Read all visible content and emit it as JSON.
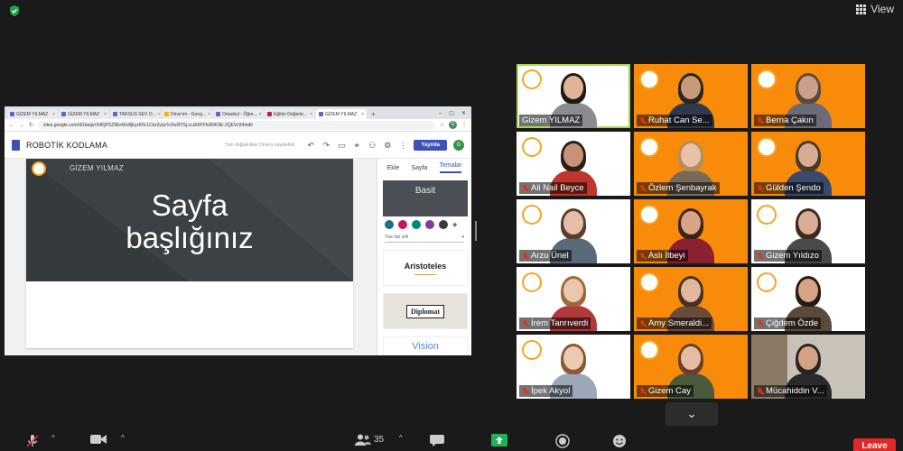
{
  "top": {
    "view_label": "View"
  },
  "browser": {
    "tabs": [
      {
        "label": "GİZEM YILMAZ"
      },
      {
        "label": "GİZEM YILMAZ"
      },
      {
        "label": "TARSUS SEV O..."
      },
      {
        "label": "Drive'ım - Goog..."
      },
      {
        "label": "Ortaokul - Öğre..."
      },
      {
        "label": "Eğitim Değerle..."
      },
      {
        "label": "GİZEM YILMAZ"
      }
    ],
    "url": "sites.google.com/d/1baijuVh8QF5Z9EeWc8jkyzKfIc1Ckz2y/p/1c5u6lYSj-cczk6FFfxR9K3E-2QEVc94/edit",
    "site_title": "ROBOTİK KODLAMA",
    "draft_note": "Tüm değişiklikler Drive'a kaydedildi",
    "publish_label": "Yayınla",
    "avatar_letter": "G",
    "hero_name": "GİZEM YILMAZ",
    "hero_title_line1": "Sayfa",
    "hero_title_line2": "başlığınız",
    "panel_tabs": [
      "Ekle",
      "Sayfa",
      "Temalar"
    ],
    "theme_selected": "Basit",
    "font_style": "Yazı tipi stili",
    "themes": [
      "Aristoteles",
      "Diplomat",
      "Vision"
    ],
    "swatch_colors": [
      "#1f6f8b",
      "#c2185b",
      "#00897b",
      "#7b3fa0",
      "#3b3b3b"
    ]
  },
  "participants": [
    {
      "name": "Gizem YILMAZ",
      "bg": "white",
      "muted": false,
      "active": true,
      "hair": "#1e1a18",
      "skin": "#e2b497",
      "shirt": "#8a8d90"
    },
    {
      "name": "Ruhat Can Se...",
      "bg": "orange",
      "muted": true,
      "active": false,
      "hair": "#2a2522",
      "skin": "#c7987a",
      "shirt": "#2f3b4a"
    },
    {
      "name": "Berna Çakın",
      "bg": "orange",
      "muted": true,
      "active": false,
      "hair": "#5a4a3a",
      "skin": "#caa08a",
      "shirt": "#6b6b7a"
    },
    {
      "name": "Ali Nail Beyce",
      "bg": "white",
      "muted": true,
      "active": false,
      "hair": "#2a2018",
      "skin": "#c89276",
      "shirt": "#c0362c"
    },
    {
      "name": "Özlem Şenbayrak",
      "bg": "orange",
      "muted": true,
      "active": false,
      "hair": "#b58c5a",
      "skin": "#e8c2a8",
      "shirt": "#7a6a5a"
    },
    {
      "name": "Gülden Şendo",
      "bg": "orange",
      "muted": true,
      "active": false,
      "hair": "#4a3a2a",
      "skin": "#d9ab92",
      "shirt": "#3a4a6a"
    },
    {
      "name": "Arzu Ünel",
      "bg": "white",
      "muted": true,
      "active": false,
      "hair": "#5a3d2a",
      "skin": "#e4bea6",
      "shirt": "#5a6a7a"
    },
    {
      "name": "Aslı İlbeyi",
      "bg": "orange",
      "muted": true,
      "active": false,
      "hair": "#3a2418",
      "skin": "#d8a488",
      "shirt": "#8a2030"
    },
    {
      "name": "Gizem Yıldızo",
      "bg": "white",
      "muted": true,
      "active": false,
      "hair": "#3a2a20",
      "skin": "#d9ad95",
      "shirt": "#4a4a4a"
    },
    {
      "name": "İrem Tanrıverdi",
      "bg": "white",
      "muted": true,
      "active": false,
      "hair": "#9a6a3a",
      "skin": "#ecc6ad",
      "shirt": "#b03a3a"
    },
    {
      "name": "Amy Smeraldi...",
      "bg": "orange",
      "muted": true,
      "active": false,
      "hair": "#4a3020",
      "skin": "#e2b79e",
      "shirt": "#6a4a3a"
    },
    {
      "name": "Çiğdem Özde",
      "bg": "white",
      "muted": true,
      "active": false,
      "hair": "#2a1a14",
      "skin": "#d5a386",
      "shirt": "#5a4a3a"
    },
    {
      "name": "İpek Akyol",
      "bg": "white",
      "muted": true,
      "active": false,
      "hair": "#8a5a32",
      "skin": "#ecc9b2",
      "shirt": "#9aa8b8"
    },
    {
      "name": "Gizem Cay",
      "bg": "orange",
      "muted": true,
      "active": false,
      "hair": "#6a4028",
      "skin": "#e6bca2",
      "shirt": "#4a5a3a"
    },
    {
      "name": "Mücahiddin V...",
      "bg": "room",
      "muted": true,
      "active": false,
      "hair": "#2a2420",
      "skin": "#d3a285",
      "shirt": "#2a2a2a"
    }
  ],
  "toolbar": {
    "participants_count": "35",
    "leave_label": "Leave"
  },
  "colors": {
    "accent_green": "#a6d84a",
    "tile_orange": "#f98b0a",
    "leave_red": "#e02828",
    "sites_blue": "#3f51b5"
  }
}
